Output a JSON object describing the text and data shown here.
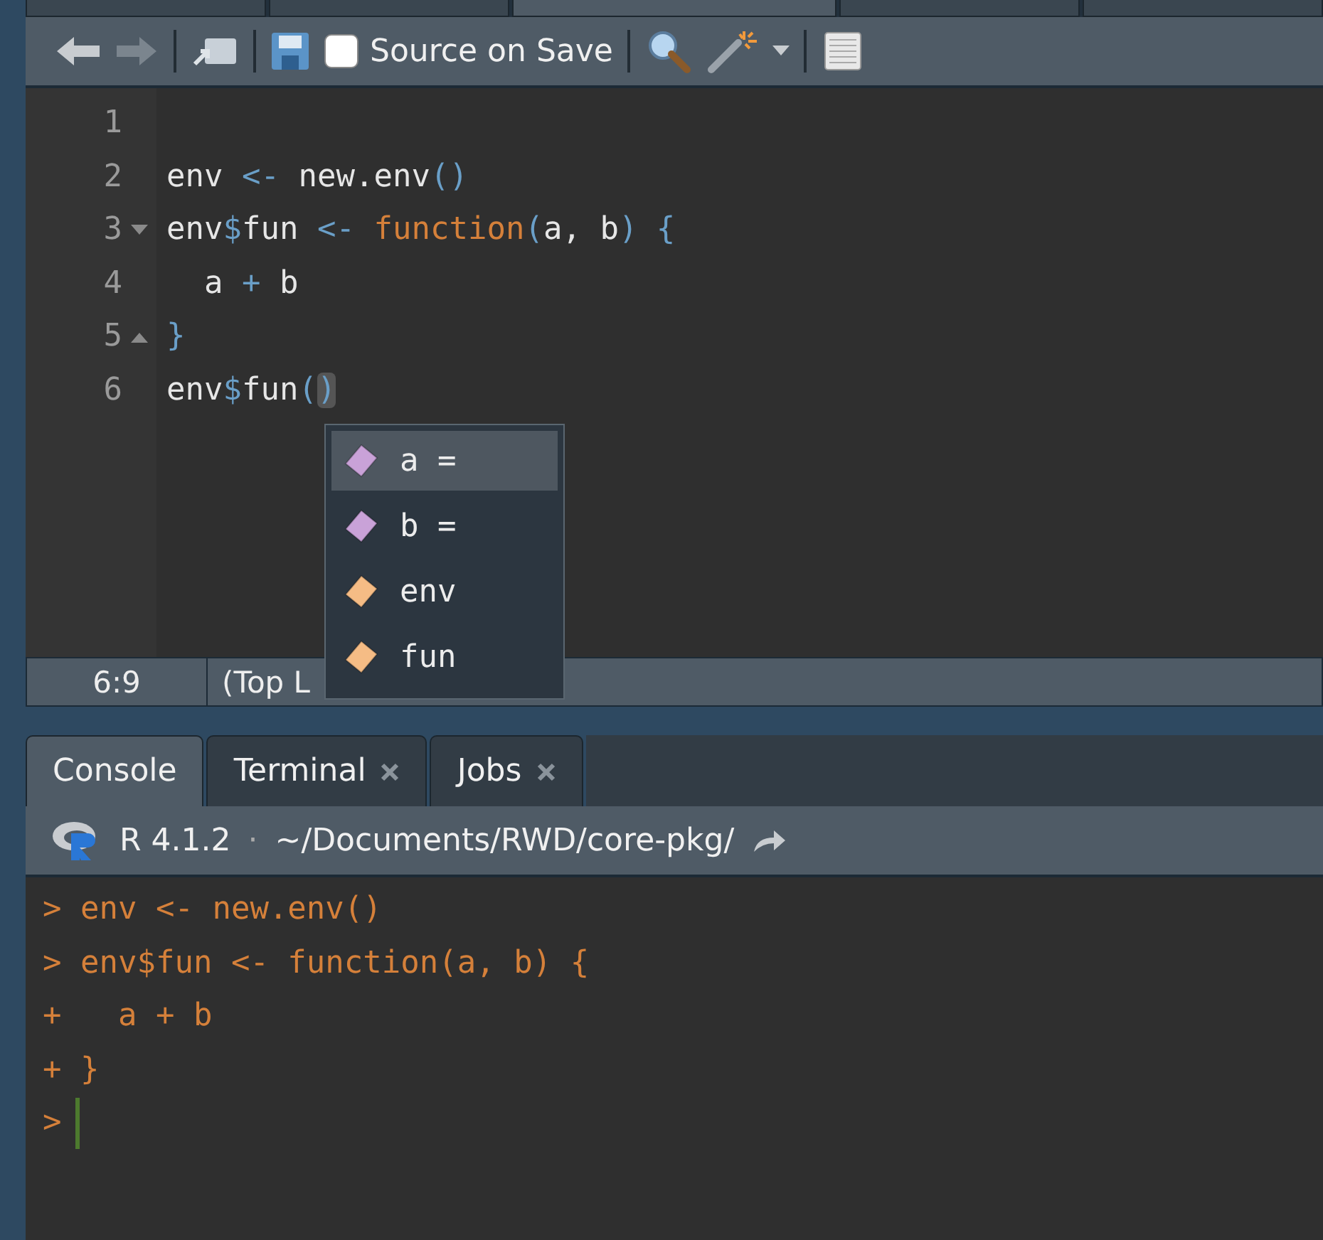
{
  "editor_tabs": [
    {
      "selected": false
    },
    {
      "selected": false
    },
    {
      "selected": true
    },
    {
      "selected": false
    },
    {
      "selected": false
    }
  ],
  "toolbar": {
    "source_on_save": {
      "label": "Source on Save",
      "checked": false
    }
  },
  "editor": {
    "lines": [
      {
        "number": "1"
      },
      {
        "number": "2",
        "tokens": [
          {
            "kind": "plain",
            "text": "env "
          },
          {
            "kind": "op",
            "text": "<-"
          },
          {
            "kind": "plain",
            "text": " new.env"
          },
          {
            "kind": "op",
            "text": "()"
          }
        ]
      },
      {
        "number": "3",
        "fold_start": true,
        "tokens": [
          {
            "kind": "plain",
            "text": "env"
          },
          {
            "kind": "op",
            "text": "$"
          },
          {
            "kind": "plain",
            "text": "fun "
          },
          {
            "kind": "op",
            "text": "<- "
          },
          {
            "kind": "keyword",
            "text": "function"
          },
          {
            "kind": "op",
            "text": "("
          },
          {
            "kind": "plain",
            "text": "a, b"
          },
          {
            "kind": "op",
            "text": ") {"
          }
        ]
      },
      {
        "number": "4",
        "tokens": [
          {
            "kind": "plain",
            "text": "  a "
          },
          {
            "kind": "op",
            "text": "+"
          },
          {
            "kind": "plain",
            "text": " b"
          }
        ]
      },
      {
        "number": "5",
        "fold_end": true,
        "tokens": [
          {
            "kind": "op",
            "text": "}"
          }
        ]
      },
      {
        "number": "6",
        "tokens": [
          {
            "kind": "plain",
            "text": "env"
          },
          {
            "kind": "op",
            "text": "$"
          },
          {
            "kind": "plain",
            "text": "fun"
          },
          {
            "kind": "op",
            "text": "("
          },
          {
            "kind": "match",
            "text": ")"
          }
        ]
      }
    ]
  },
  "completions": [
    {
      "kind": "argument",
      "label": "a =",
      "selected": true
    },
    {
      "kind": "argument",
      "label": "b =",
      "selected": false
    },
    {
      "kind": "variable",
      "label": "env",
      "selected": false
    },
    {
      "kind": "variable",
      "label": "fun",
      "selected": false
    }
  ],
  "status_bar": {
    "position": "6:9",
    "scope": "(Top L"
  },
  "console": {
    "tabs": [
      {
        "label": "Console",
        "selected": true,
        "closable": false
      },
      {
        "label": "Terminal",
        "selected": false,
        "closable": true
      },
      {
        "label": "Jobs",
        "selected": false,
        "closable": true
      }
    ],
    "version": "R 4.1.2",
    "separator": "·",
    "path": "~/Documents/RWD/core-pkg/",
    "lines": [
      "> env <- new.env()",
      "> env$fun <- function(a, b) {",
      "+   a + b",
      "+ }",
      ">"
    ]
  }
}
